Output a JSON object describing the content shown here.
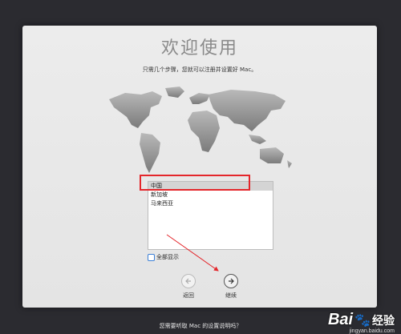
{
  "window": {
    "title": "欢迎使用",
    "subtitle": "只需几个步骤，您就可以注册并设置好 Mac。"
  },
  "country_list": {
    "items": [
      "中国",
      "新加坡",
      "马来西亚"
    ],
    "selected_index": 0
  },
  "show_all": {
    "label": "全部显示",
    "checked": false
  },
  "nav": {
    "back_label": "返回",
    "next_label": "继续"
  },
  "footer": {
    "text": "您需要听取 Mac 的设置说明吗？"
  },
  "watermark": {
    "logo": "Bai",
    "suffix": "经验",
    "url": "jingyan.baidu.com"
  },
  "colors": {
    "annotation": "#e4262b",
    "checkbox_accent": "#3b7fd6"
  }
}
